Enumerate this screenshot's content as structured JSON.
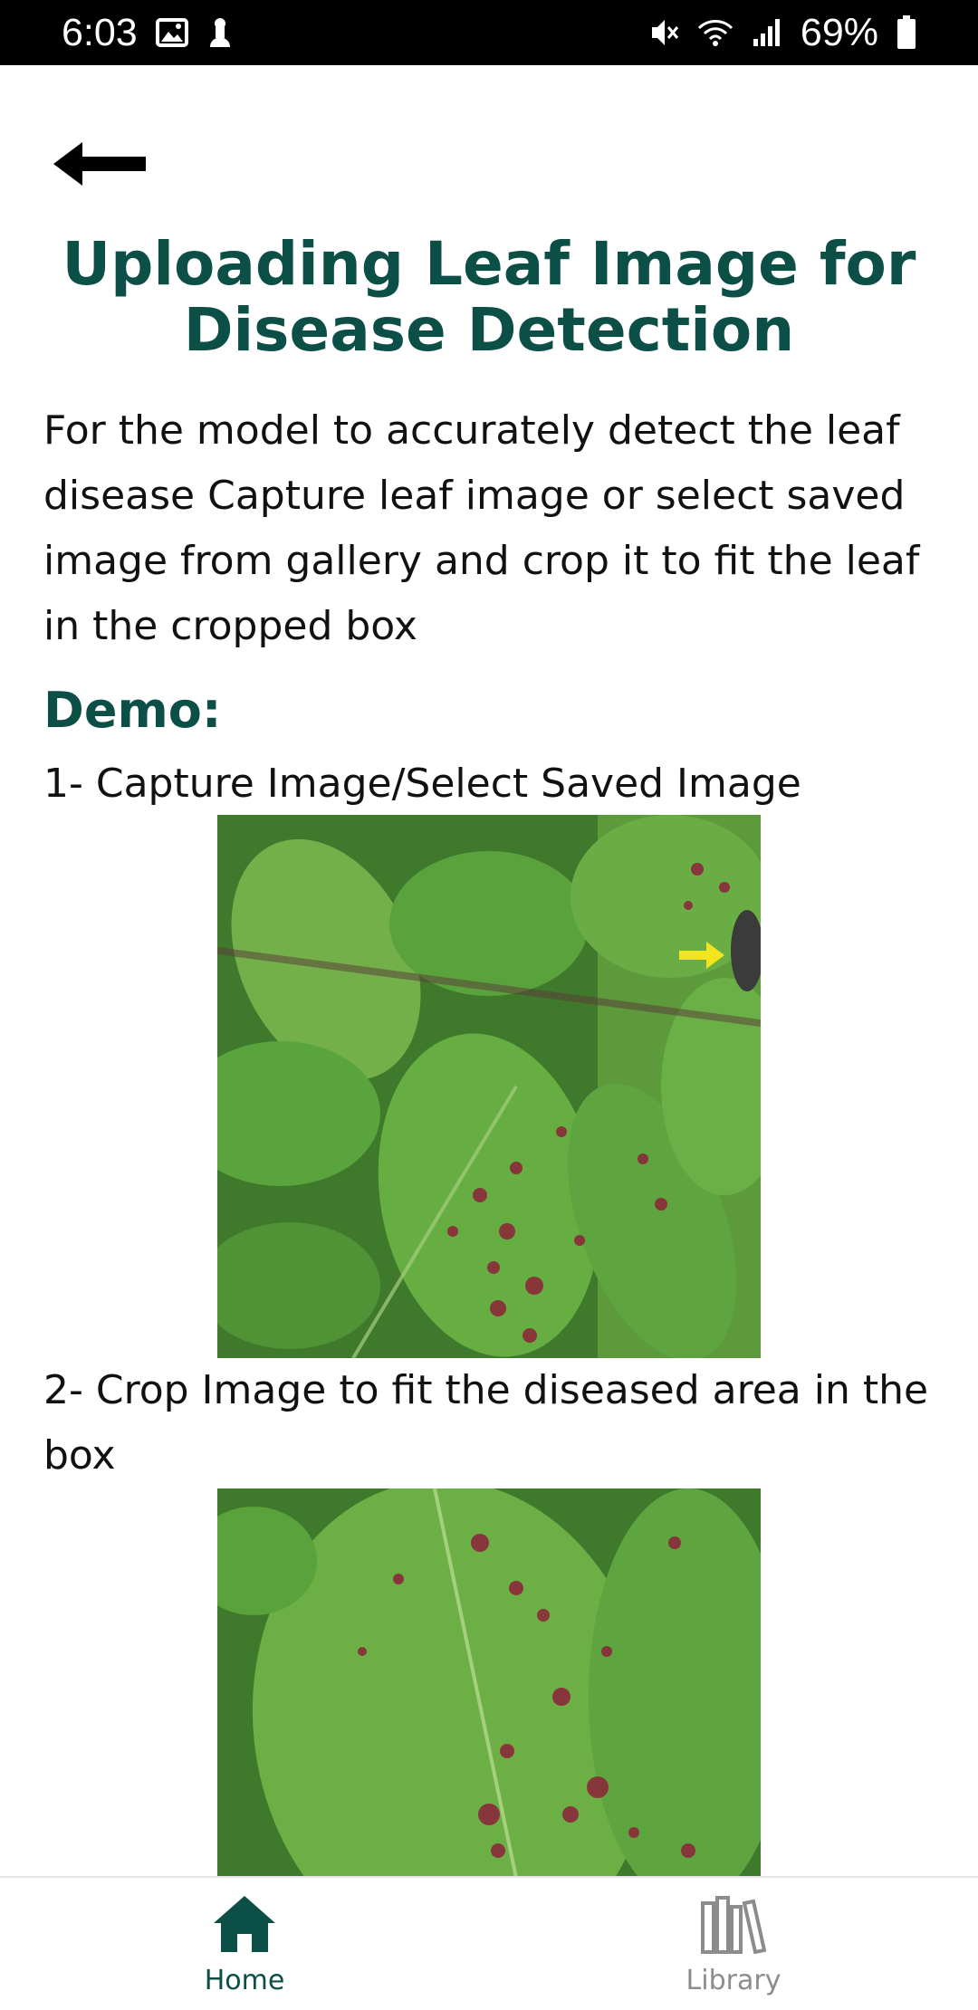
{
  "status_bar": {
    "time": "6:03",
    "battery": "69%",
    "icons": [
      "image-icon",
      "notification-icon",
      "mute-icon",
      "wifi-icon",
      "signal-icon",
      "battery-icon"
    ]
  },
  "header": {
    "back_icon": "arrow-left-icon"
  },
  "page": {
    "title": "Uploading Leaf Image for Disease Detection",
    "intro": "For the model to accurately detect the leaf disease Capture leaf image or select saved image from gallery and crop it to fit the leaf in the cropped box",
    "demo_heading": "Demo:",
    "step_1": "1- Capture Image/Select Saved Image",
    "step_2": "2- Crop Image to fit the diseased area in the box"
  },
  "bottom_nav": {
    "items": [
      {
        "label": "Home",
        "icon": "home-icon",
        "active": true
      },
      {
        "label": "Library",
        "icon": "library-icon",
        "active": false
      }
    ]
  },
  "colors": {
    "accent": "#0b4f46",
    "inactive": "#8c8c8c",
    "status_bar": "#000000"
  }
}
